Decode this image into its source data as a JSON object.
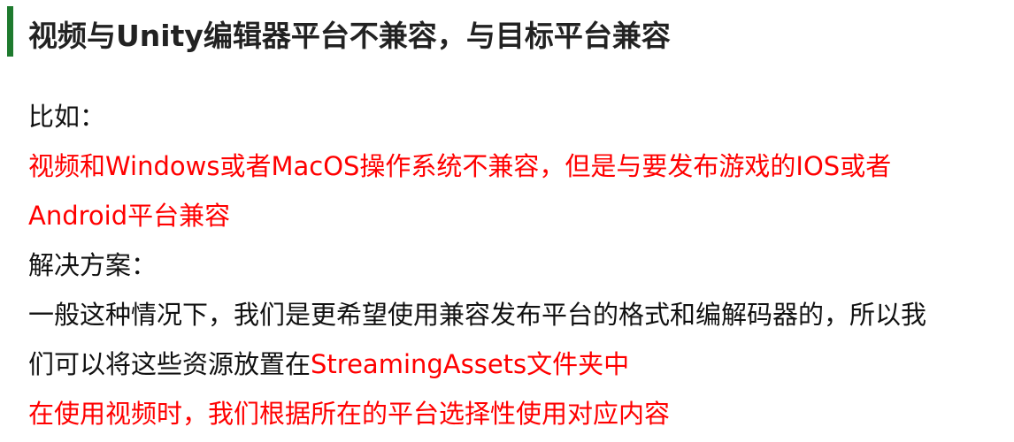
{
  "colors": {
    "accent": "#1e7a2e",
    "highlight": "#ff0000",
    "text": "#111111"
  },
  "title": "视频与Unity编辑器平台不兼容，与目标平台兼容",
  "lines": [
    [
      {
        "text": "比如：",
        "color": "black"
      }
    ],
    [
      {
        "text": "视频和Windows或者MacOS操作系统不兼容，但是与要发布游戏的IOS或者",
        "color": "red"
      }
    ],
    [
      {
        "text": "Android平台兼容",
        "color": "red"
      }
    ],
    [
      {
        "text": "解决方案：",
        "color": "black"
      }
    ],
    [
      {
        "text": "一般这种情况下，我们是更希望使用兼容发布平台的格式和编解码器的，所以我",
        "color": "black"
      }
    ],
    [
      {
        "text": "们可以将这些资源放置在",
        "color": "black"
      },
      {
        "text": "StreamingAssets文件夹中",
        "color": "red"
      }
    ],
    [
      {
        "text": "在使用视频时，我们根据所在的平台选择性使用对应内容",
        "color": "red"
      }
    ]
  ]
}
